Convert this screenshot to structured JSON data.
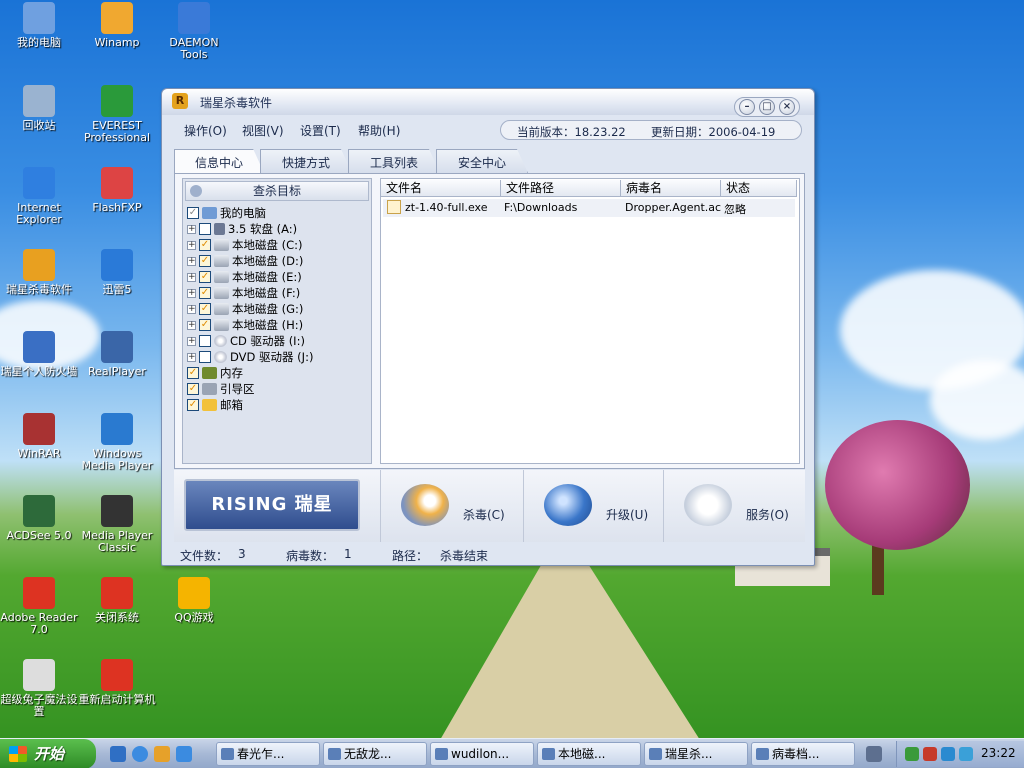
{
  "desktop_icons": [
    {
      "label": "我的电脑",
      "icon": "computer-icon"
    },
    {
      "label": "Winamp",
      "icon": "winamp-icon"
    },
    {
      "label": "DAEMON Tools",
      "icon": "daemon-tools-icon"
    },
    {
      "label": "回收站",
      "icon": "recycle-bin-icon"
    },
    {
      "label": "EVEREST Professional",
      "icon": "everest-icon"
    },
    {
      "label": "Internet Explorer",
      "icon": "ie-icon"
    },
    {
      "label": "FlashFXP",
      "icon": "flashfxp-icon"
    },
    {
      "label": "瑞星杀毒软件",
      "icon": "rising-antivirus-icon"
    },
    {
      "label": "迅雷5",
      "icon": "xunlei-icon"
    },
    {
      "label": "瑞星个人防火墙",
      "icon": "rising-firewall-icon"
    },
    {
      "label": "RealPlayer",
      "icon": "realplayer-icon"
    },
    {
      "label": "WinRAR",
      "icon": "winrar-icon"
    },
    {
      "label": "Windows Media Player",
      "icon": "wmp-icon"
    },
    {
      "label": "ACDSee 5.0",
      "icon": "acdsee-icon"
    },
    {
      "label": "Media Player Classic",
      "icon": "mpc-icon"
    },
    {
      "label": "Adobe Reader 7.0",
      "icon": "adobe-reader-icon"
    },
    {
      "label": "关闭系统",
      "icon": "shutdown-icon"
    },
    {
      "label": "QQ游戏",
      "icon": "qq-game-icon"
    },
    {
      "label": "超级兔子魔法设置",
      "icon": "rabbit-icon"
    },
    {
      "label": "重新启动计算机",
      "icon": "restart-icon"
    }
  ],
  "window": {
    "title": "瑞星杀毒软件",
    "controls": {
      "minimize": "–",
      "restore": "□",
      "close": "×"
    },
    "menu": [
      "操作(O)",
      "视图(V)",
      "设置(T)",
      "帮助(H)"
    ],
    "version_label": "当前版本：18.23.22",
    "update_label": "更新日期：2006-04-19",
    "tabs": [
      "信息中心",
      "快捷方式",
      "工具列表",
      "安全中心"
    ],
    "left_header": "查杀目标",
    "tree": [
      {
        "label": "我的电脑",
        "icon": "pc",
        "checked": "partial",
        "indent": 0
      },
      {
        "label": "3.5 软盘 (A:)",
        "icon": "floppy",
        "checked": false,
        "indent": 1
      },
      {
        "label": "本地磁盘 (C:)",
        "icon": "drive",
        "checked": true,
        "indent": 1
      },
      {
        "label": "本地磁盘 (D:)",
        "icon": "drive",
        "checked": true,
        "indent": 1
      },
      {
        "label": "本地磁盘 (E:)",
        "icon": "drive",
        "checked": true,
        "indent": 1
      },
      {
        "label": "本地磁盘 (F:)",
        "icon": "drive",
        "checked": true,
        "indent": 1
      },
      {
        "label": "本地磁盘 (G:)",
        "icon": "drive",
        "checked": true,
        "indent": 1
      },
      {
        "label": "本地磁盘 (H:)",
        "icon": "drive",
        "checked": true,
        "indent": 1
      },
      {
        "label": "CD 驱动器 (I:)",
        "icon": "cd",
        "checked": false,
        "indent": 1
      },
      {
        "label": "DVD 驱动器 (J:)",
        "icon": "cd",
        "checked": false,
        "indent": 1
      },
      {
        "label": "内存",
        "icon": "mem",
        "checked": true,
        "indent": 0
      },
      {
        "label": "引导区",
        "icon": "boot",
        "checked": true,
        "indent": 0
      },
      {
        "label": "邮箱",
        "icon": "mail",
        "checked": true,
        "indent": 0
      }
    ],
    "columns": [
      "文件名",
      "文件路径",
      "病毒名",
      "状态"
    ],
    "rows": [
      {
        "file": "zt-1.40-full.exe",
        "path": "F:\\Downloads",
        "virus": "Dropper.Agent.ac",
        "status": "忽略"
      }
    ],
    "brand": "RISING 瑞星",
    "actions": [
      {
        "label": "杀毒(C)",
        "icon": "magnifier-scan-icon"
      },
      {
        "label": "升级(U)",
        "icon": "globe-upgrade-icon"
      },
      {
        "label": "服务(O)",
        "icon": "handshake-service-icon"
      }
    ],
    "status": {
      "files_label": "文件数：",
      "files": "3",
      "virus_label": "病毒数：",
      "virus_count": "1",
      "path_label": "路径：",
      "path_value": "杀毒结束"
    }
  },
  "taskbar": {
    "start_label": "开始",
    "tasks": [
      "春光乍...",
      "无敌龙...",
      "wudilon...",
      "本地磁...",
      "瑞星杀...",
      "病毒档..."
    ],
    "clock": "23:22"
  }
}
